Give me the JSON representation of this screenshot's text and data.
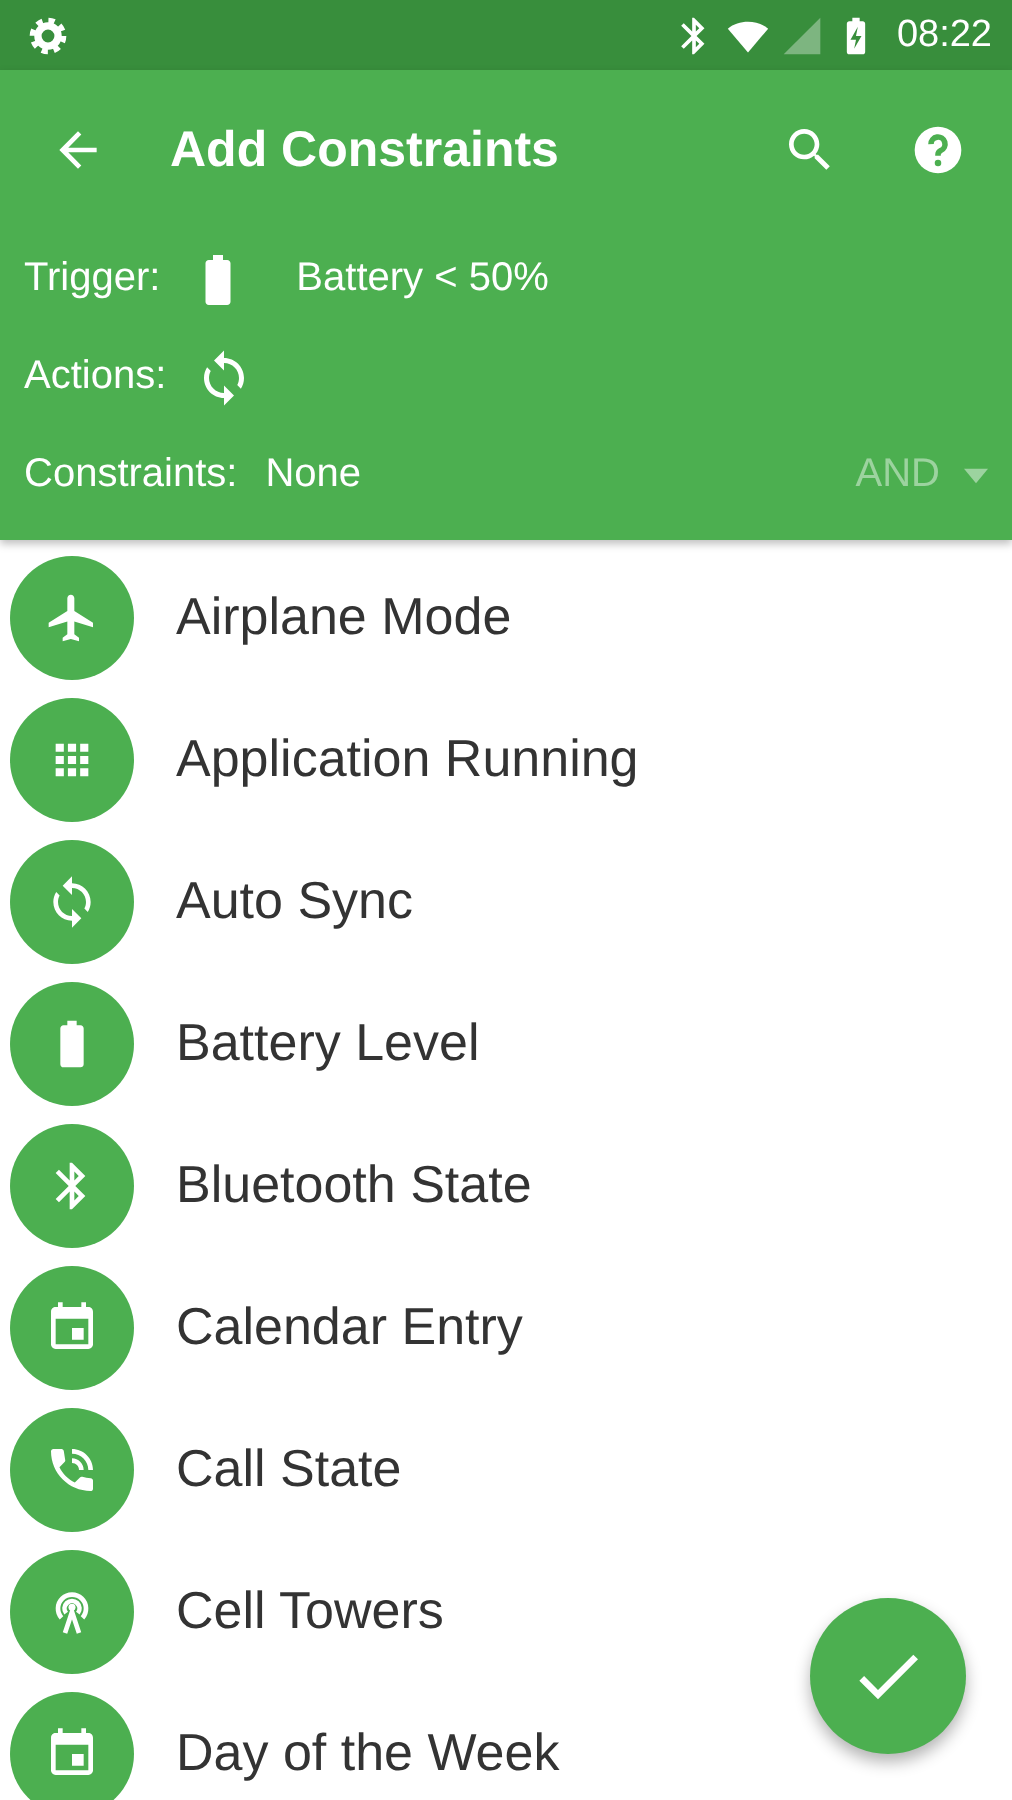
{
  "status_bar": {
    "time": "08:22"
  },
  "app_bar": {
    "title": "Add Constraints"
  },
  "summary": {
    "trigger_label": "Trigger:",
    "trigger_value": "Battery < 50%",
    "actions_label": "Actions:",
    "constraints_label": "Constraints:",
    "constraints_value": "None",
    "logic": {
      "label": "AND",
      "disabled": true
    }
  },
  "items": [
    {
      "label": "Airplane Mode",
      "kind": "airplane"
    },
    {
      "label": "Application Running",
      "kind": "apps"
    },
    {
      "label": "Auto Sync",
      "kind": "sync"
    },
    {
      "label": "Battery Level",
      "kind": "battery"
    },
    {
      "label": "Bluetooth State",
      "kind": "bluetooth"
    },
    {
      "label": "Calendar Entry",
      "kind": "calendar"
    },
    {
      "label": "Call State",
      "kind": "call"
    },
    {
      "label": "Cell Towers",
      "kind": "tower"
    },
    {
      "label": "Day of the Week",
      "kind": "calendar"
    }
  ]
}
